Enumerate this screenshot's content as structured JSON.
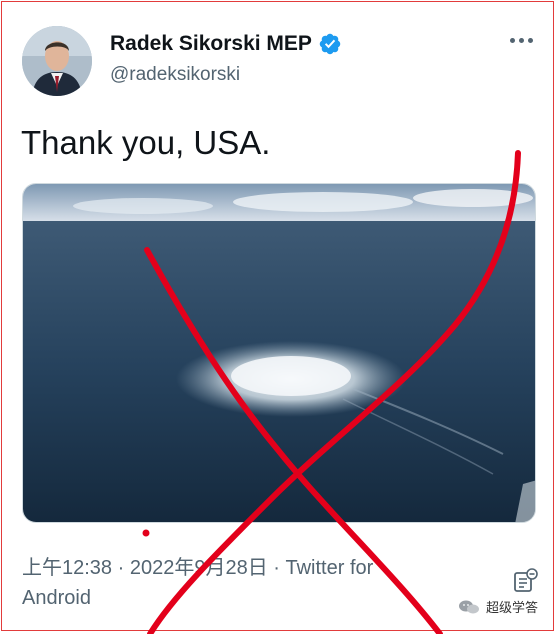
{
  "tweet": {
    "author_name": "Radek Sikorski MEP",
    "handle": "@radeksikorski",
    "text": "Thank you, USA.",
    "time": "上午12:38",
    "date": "2022年9月28日",
    "separator": " · ",
    "source": "Twitter for Android",
    "media_alt": "Aerial view of gas bubbles on the sea surface"
  },
  "icons": {
    "verified": "verified-badge-icon",
    "more": "more-options-icon",
    "analytics": "analytics-icon"
  },
  "watermark": {
    "text": "超级学答"
  },
  "colors": {
    "verified_blue": "#1d9bf0",
    "cross_red": "#e3001b",
    "secondary_text": "#536471"
  }
}
